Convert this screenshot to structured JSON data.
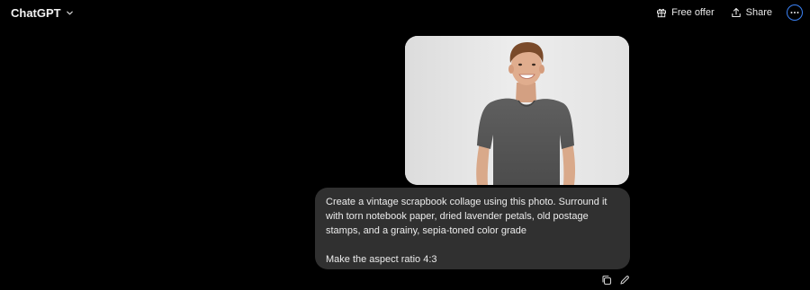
{
  "header": {
    "model_name": "ChatGPT",
    "free_offer_label": "Free offer",
    "share_label": "Share"
  },
  "message": {
    "paragraph1": "Create a vintage scrapbook collage using this photo. Surround it with torn notebook paper, dried lavender petals, old postage stamps, and a grainy, sepia-toned color grade",
    "paragraph2": "Make the aspect ratio 4:3"
  },
  "icons": {
    "model_chevron": "chevron-down-icon",
    "free_offer": "gift-icon",
    "share": "share-icon",
    "more": "more-options-icon",
    "copy": "copy-icon",
    "edit": "edit-icon"
  },
  "colors": {
    "background": "#000000",
    "bubble": "#303030",
    "text": "#ececec",
    "accent_ring": "#3b82f6"
  }
}
